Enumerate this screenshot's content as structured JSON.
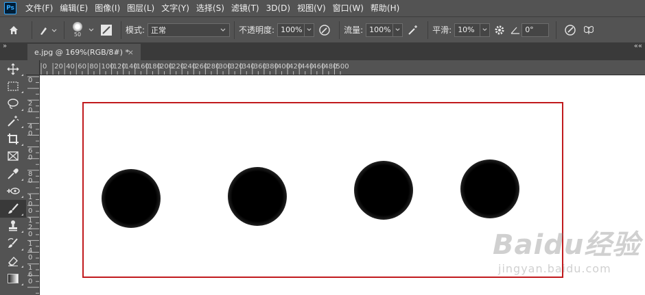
{
  "app": {
    "logo": "Ps"
  },
  "menu": [
    "文件(F)",
    "编辑(E)",
    "图像(I)",
    "图层(L)",
    "文字(Y)",
    "选择(S)",
    "滤镜(T)",
    "3D(D)",
    "视图(V)",
    "窗口(W)",
    "帮助(H)"
  ],
  "options": {
    "brush_size": "50",
    "mode_label": "模式:",
    "mode_value": "正常",
    "opacity_label": "不透明度:",
    "opacity_value": "100%",
    "flow_label": "流量:",
    "flow_value": "100%",
    "smoothing_label": "平滑:",
    "smoothing_value": "10%",
    "angle_value": "0°"
  },
  "tabs": {
    "collapse_left": "»",
    "collapse_right": "««",
    "document_title": "e.jpg @ 169%(RGB/8#) *",
    "close": "×"
  },
  "ruler": {
    "top_labels": [
      "0",
      "20",
      "40",
      "60",
      "80",
      "100",
      "120",
      "140",
      "160",
      "180",
      "200",
      "220",
      "240",
      "260",
      "280",
      "300",
      "320",
      "340",
      "360",
      "380",
      "400",
      "420",
      "440",
      "460",
      "480",
      "500"
    ],
    "left_labels": [
      "0",
      "2\n0",
      "4\n0",
      "6\n0",
      "8\n0",
      "1\n0\n0",
      "1\n2\n0",
      "1\n4\n0",
      "1\n6\n0"
    ]
  },
  "watermark": {
    "main": "Baidu经验",
    "sub": "jingyan.baidu.com"
  },
  "colors": {
    "selection": "#c0191c",
    "ui_bg": "#535353",
    "canvas": "#ffffff"
  }
}
